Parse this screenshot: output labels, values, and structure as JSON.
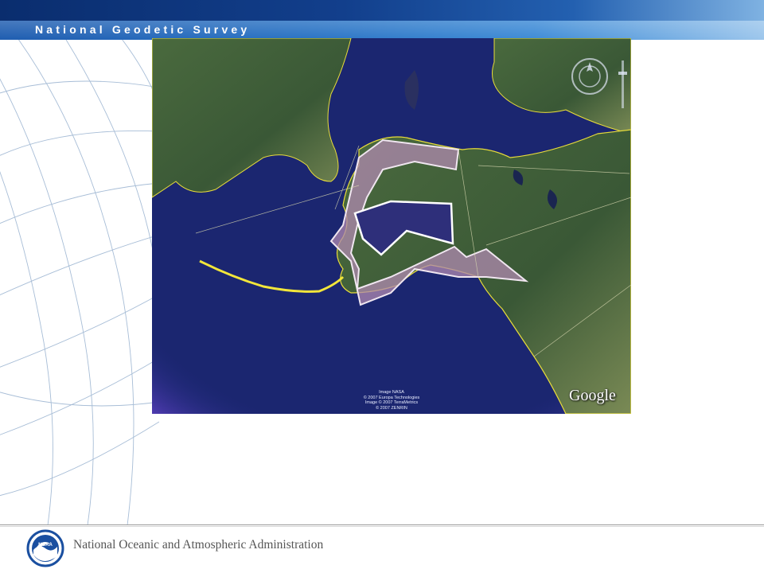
{
  "header": {
    "title": "National Geodetic Survey"
  },
  "map": {
    "attribution": [
      "Image NASA",
      "© 2007 Europa Technologies",
      "Image © 2007 TerraMetrics",
      "© 2007 ZENRIN"
    ],
    "logo_text": "Google",
    "icons": [
      "navigation-compass-icon",
      "zoom-slider-icon"
    ]
  },
  "footer": {
    "organization": "National Oceanic and Atmospheric Administration",
    "logo_text": "NOAA"
  },
  "colors": {
    "header_dark": "#0a2d6e",
    "header_light": "#9cc6ec",
    "ocean": "#1e2a7a",
    "land": "#3d5a3a",
    "coastline": "#f2e63a",
    "region_fill": "#b08ab0",
    "region_inner": "#2e2f7a",
    "noaa_blue": "#1a4fa0"
  }
}
